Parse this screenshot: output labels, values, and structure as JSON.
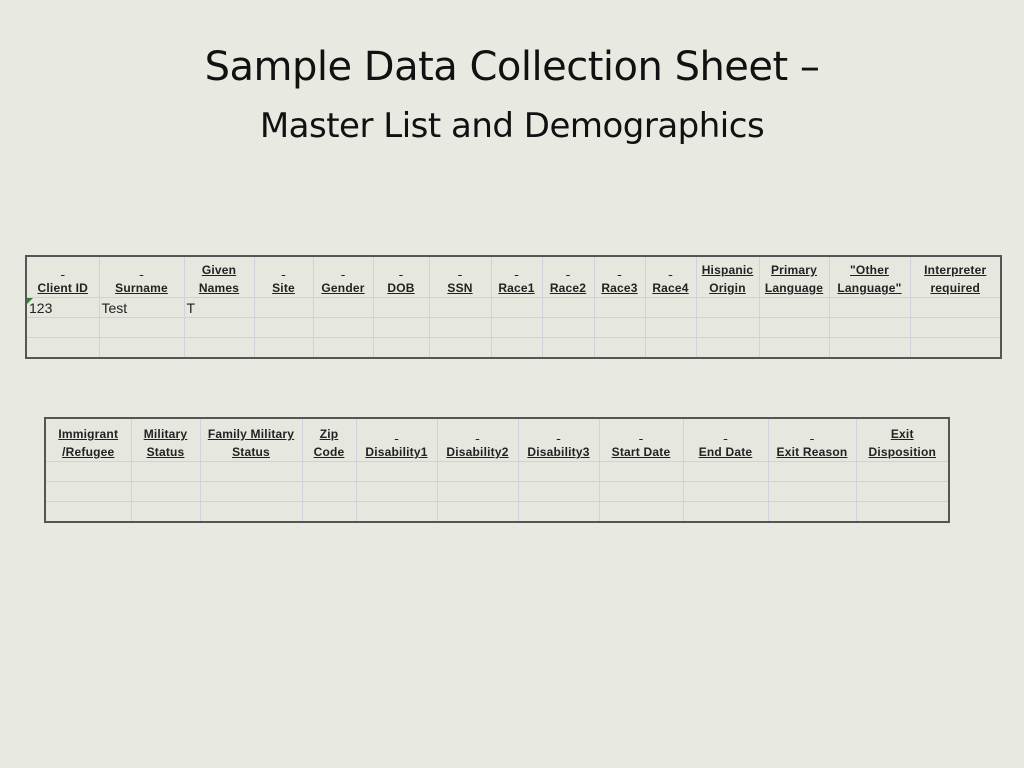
{
  "slide": {
    "title": "Sample Data Collection Sheet –",
    "subtitle": "Master List and Demographics"
  },
  "table1": {
    "headers": [
      [
        "",
        "Client ID"
      ],
      [
        "",
        "Surname"
      ],
      [
        "Given",
        "Names"
      ],
      [
        "",
        "Site"
      ],
      [
        "",
        "Gender"
      ],
      [
        "",
        "DOB"
      ],
      [
        "",
        "SSN"
      ],
      [
        "",
        "Race1"
      ],
      [
        "",
        "Race2"
      ],
      [
        "",
        "Race3"
      ],
      [
        "",
        "Race4"
      ],
      [
        "Hispanic",
        "Origin"
      ],
      [
        "Primary",
        "Language"
      ],
      [
        "\"Other",
        "Language\""
      ],
      [
        "Interpreter",
        "required"
      ]
    ],
    "rows": [
      [
        "123",
        "Test",
        "T",
        "",
        "",
        "",
        "",
        "",
        "",
        "",
        "",
        "",
        "",
        "",
        ""
      ],
      [
        "",
        "",
        "",
        "",
        "",
        "",
        "",
        "",
        "",
        "",
        "",
        "",
        "",
        "",
        ""
      ],
      [
        "",
        "",
        "",
        "",
        "",
        "",
        "",
        "",
        "",
        "",
        "",
        "",
        "",
        "",
        ""
      ]
    ]
  },
  "table2": {
    "headers": [
      [
        "Immigrant",
        "/Refugee"
      ],
      [
        "Military",
        "Status"
      ],
      [
        "Family Military",
        "Status"
      ],
      [
        "Zip",
        "Code"
      ],
      [
        "",
        "Disability1"
      ],
      [
        "",
        "Disability2"
      ],
      [
        "",
        "Disability3"
      ],
      [
        "",
        "Start Date"
      ],
      [
        "",
        "End Date"
      ],
      [
        "",
        "Exit Reason"
      ],
      [
        "Exit",
        "Disposition"
      ]
    ],
    "rows": [
      [
        "",
        "",
        "",
        "",
        "",
        "",
        "",
        "",
        "",
        "",
        ""
      ],
      [
        "",
        "",
        "",
        "",
        "",
        "",
        "",
        "",
        "",
        "",
        ""
      ],
      [
        "",
        "",
        "",
        "",
        "",
        "",
        "",
        "",
        "",
        "",
        ""
      ]
    ]
  }
}
